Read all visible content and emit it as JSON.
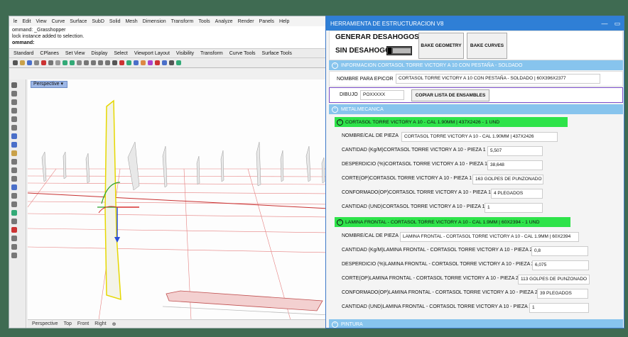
{
  "rhino": {
    "menu": [
      "le",
      "Edit",
      "View",
      "Curve",
      "Surface",
      "SubD",
      "Solid",
      "Mesh",
      "Dimension",
      "Transform",
      "Tools",
      "Analyze",
      "Render",
      "Panels",
      "Help"
    ],
    "command_lines": [
      "ommand: _Grasshopper",
      "lock instance added to selection.",
      "ommand:"
    ],
    "tabs": [
      "Standard",
      "CPlanes",
      "Set View",
      "Display",
      "Select",
      "Viewport Layout",
      "Visibility",
      "Transform",
      "Curve Tools",
      "Surface Tools"
    ],
    "viewport_tab": "Perspective",
    "bottom_tabs": [
      "Perspective",
      "Top",
      "Front",
      "Right",
      "⊕"
    ]
  },
  "panel": {
    "title": "HERRAMIENTA DE ESTRUCTURACION V8",
    "controls": [
      "—",
      "▭"
    ],
    "generar": "GENERAR DESAHOGOS",
    "sin": "SIN DESAHOGOS",
    "bake_geometry": "BAKE GEOMETRY",
    "bake_curves": "BAKE CURVES",
    "info_section": "INFORMACION CORTASOL TORRE VICTORY A 10 CON PESTAÑA - SOLDADO",
    "nombre_epicor_label": "NOMBRE PARA EPICOR",
    "nombre_epicor_value": "CORTASOL TORRE VICTORY A 10 CON PESTAÑA - SOLDADO | 60X396X2377",
    "dibujo_label": "DIBUJO",
    "dibujo_value": "POXXXXX",
    "copiar": "COPIAR LISTA DE ENSAMBLES",
    "metal_section": "METALMECANICA",
    "pieces": [
      {
        "header": "CORTASOL TORRE VICTORY A 10 - CAL 1.90MM | 437X2426 - 1 UND",
        "rows": [
          {
            "label": "NOMBRE/CAL DE PIEZA",
            "value": "CORTASOL TORRE VICTORY A 10 - CAL 1.90MM | 437X2426"
          },
          {
            "label": "CANTIDAD (Kg/M)CORTASOL TORRE VICTORY A 10 - PIEZA 1",
            "value": "5,507"
          },
          {
            "label": "DESPERDICIO (%)CORTASOL TORRE VICTORY A 10 - PIEZA 1",
            "value": "38,648"
          },
          {
            "label": "CORTE(OP)CORTASOL TORRE VICTORY A 10 - PIEZA 1",
            "value": "163 GOLPES DE PUNZONADO"
          },
          {
            "label": "CONFORMADO(OP)CORTASOL TORRE VICTORY A 10 - PIEZA 1",
            "value": "4 PLEGADOS"
          },
          {
            "label": "CANTIDAD (UND)CORTASOL TORRE VICTORY A 10 - PIEZA 1",
            "value": "1"
          }
        ]
      },
      {
        "header": "LAMINA FRONTAL - CORTASOL TORRE VICTORY A 10 - CAL 1.9MM | 60X2394 - 1 UND",
        "rows": [
          {
            "label": "NOMBRE/CAL DE PIEZA",
            "value": "LAMINA FRONTAL - CORTASOL TORRE VICTORY A 10 - CAL 1.9MM | 60X2394"
          },
          {
            "label": "CANTIDAD (Kg/M)LAMINA FRONTAL - CORTASOL TORRE VICTORY A 10 - PIEZA 2",
            "value": "0,8"
          },
          {
            "label": "DESPERDICIO (%)LAMINA FRONTAL - CORTASOL TORRE VICTORY A 10 - PIEZA 2",
            "value": "6,075"
          },
          {
            "label": "CORTE(OP)LAMINA FRONTAL - CORTASOL TORRE VICTORY A 10 - PIEZA 2",
            "value": "113 GOLPES DE PUNZONADO"
          },
          {
            "label": "CONFORMADO(OP)LAMINA FRONTAL - CORTASOL TORRE VICTORY A 10 - PIEZA 2",
            "value": "39 PLEGADOS"
          },
          {
            "label": "CANTIDAD (UND)LAMINA FRONTAL - CORTASOL TORRE VICTORY A 10 - PIEZA 2",
            "value": "1"
          }
        ]
      }
    ],
    "pintura_section": "PINTURA",
    "colors": {
      "titlebar": "#2f7fd6",
      "section": "#87c4ed",
      "piece_header": "#2ee34a",
      "frame": "#3f6b52"
    }
  }
}
